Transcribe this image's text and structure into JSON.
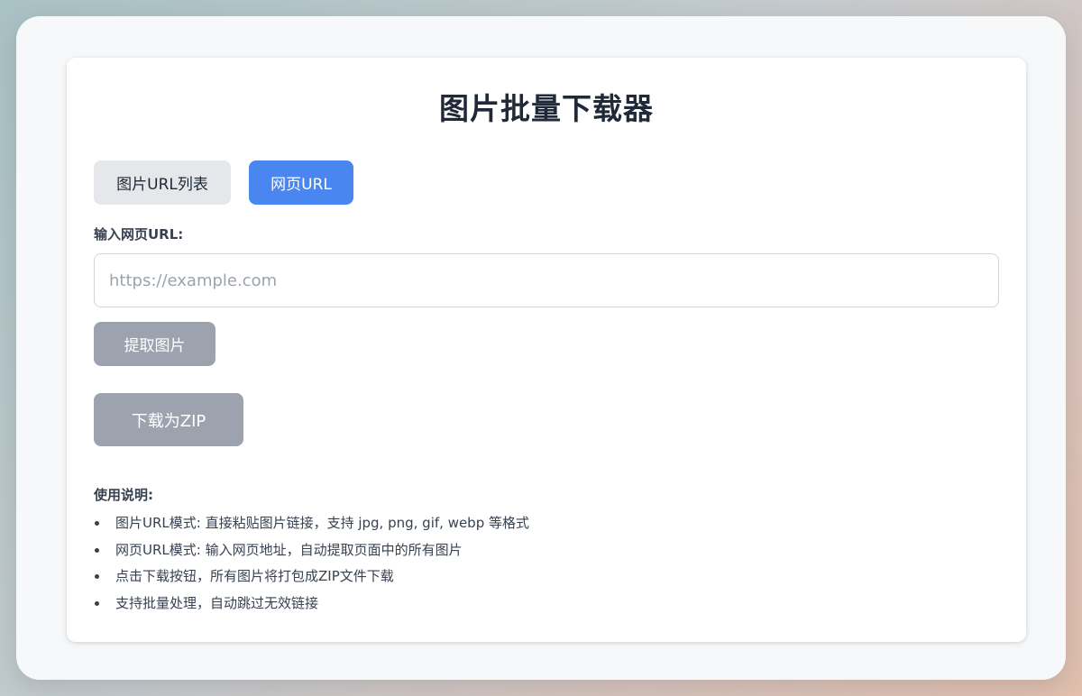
{
  "app": {
    "title": "图片批量下载器"
  },
  "tabs": [
    {
      "label": "图片URL列表",
      "active": false
    },
    {
      "label": "网页URL",
      "active": true
    }
  ],
  "input": {
    "label": "输入网页URL:",
    "value": "",
    "placeholder": "https://example.com"
  },
  "buttons": {
    "extract_label": "提取图片",
    "zip_label": "下载为ZIP"
  },
  "help": {
    "title": "使用说明:",
    "items": [
      "图片URL模式: 直接粘贴图片链接，支持 jpg, png, gif, webp 等格式",
      "网页URL模式: 输入网页地址，自动提取页面中的所有图片",
      "点击下载按钮，所有图片将打包成ZIP文件下载",
      "支持批量处理，自动跳过无效链接"
    ]
  },
  "colors": {
    "accent": "#4a86f0",
    "disabled_button": "#9ca3af",
    "inactive_tab": "#e5e7eb",
    "text": "#1f2937"
  }
}
